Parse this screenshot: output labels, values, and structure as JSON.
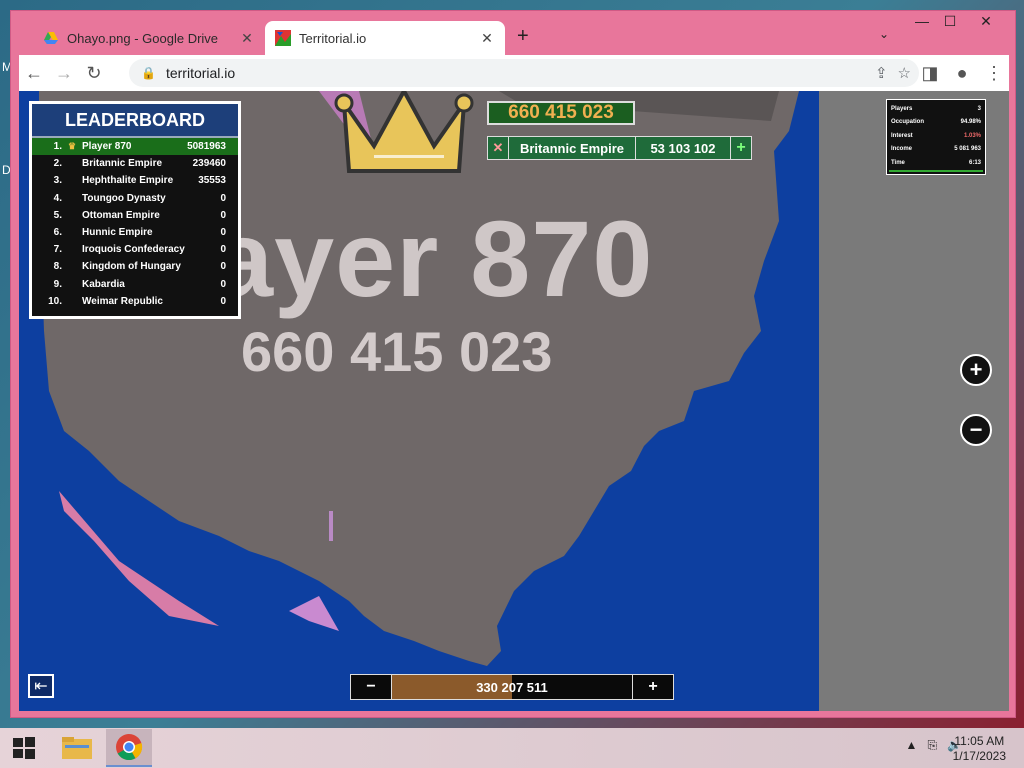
{
  "desktop": {
    "icon_letters": [
      "M",
      "D"
    ]
  },
  "browser": {
    "tabs": [
      {
        "title": "Ohayo.png - Google Drive",
        "active": false
      },
      {
        "title": "Territorial.io",
        "active": true
      }
    ],
    "new_tab": "+",
    "tab_search": "⌄",
    "window_controls": {
      "minimize": "—",
      "maximize": "☐",
      "close": "✕"
    },
    "url": "territorial.io"
  },
  "game": {
    "leaderboard": {
      "title": "LEADERBOARD",
      "rows": [
        {
          "rank": "1.",
          "name": "Player 870",
          "value": "5081963"
        },
        {
          "rank": "2.",
          "name": "Britannic Empire",
          "value": "239460"
        },
        {
          "rank": "3.",
          "name": "Hephthalite Empire",
          "value": "35553"
        },
        {
          "rank": "4.",
          "name": "Toungoo Dynasty",
          "value": "0"
        },
        {
          "rank": "5.",
          "name": "Ottoman Empire",
          "value": "0"
        },
        {
          "rank": "6.",
          "name": "Hunnic Empire",
          "value": "0"
        },
        {
          "rank": "7.",
          "name": "Iroquois Confederacy",
          "value": "0"
        },
        {
          "rank": "8.",
          "name": "Kingdom of Hungary",
          "value": "0"
        },
        {
          "rank": "9.",
          "name": "Kabardia",
          "value": "0"
        },
        {
          "rank": "10.",
          "name": "Weimar Republic",
          "value": "0"
        }
      ]
    },
    "top_score": "660 415 023",
    "target": {
      "close": "✕",
      "name": "Britannic Empire",
      "value": "53 103 102",
      "add": "+"
    },
    "big_label": {
      "name": "Player 870",
      "score": "660 415 023"
    },
    "stats": [
      {
        "label": "Players",
        "value": "3"
      },
      {
        "label": "Occupation",
        "value": "94.98%"
      },
      {
        "label": "Interest",
        "value": "1.03%"
      },
      {
        "label": "Income",
        "value": "5 081 963"
      },
      {
        "label": "Time",
        "value": "6:13"
      }
    ],
    "zoom": {
      "in": "+",
      "out": "−"
    },
    "exit_icon": "⇤",
    "troop_bar": {
      "minus": "−",
      "value": "330 207 511",
      "plus": "+",
      "fill_fraction": 0.5
    }
  },
  "taskbar": {
    "clock_time": "11:05 AM",
    "clock_date": "1/17/2023",
    "tray_icons": [
      "▲",
      "⎘",
      "🔈"
    ]
  }
}
